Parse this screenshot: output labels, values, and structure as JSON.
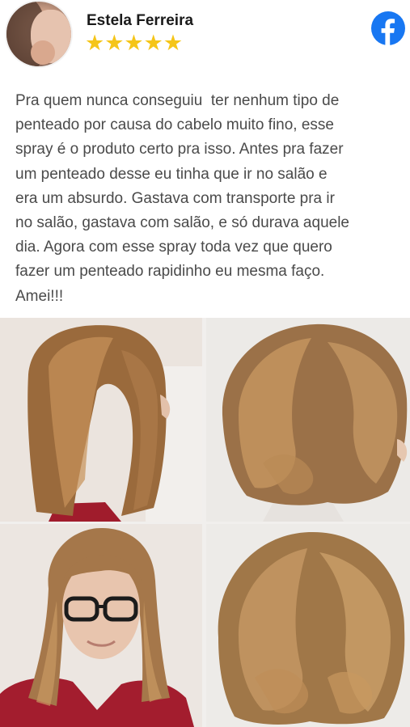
{
  "reviewer": {
    "name": "Estela Ferreira",
    "stars": "★★★★★"
  },
  "review": {
    "text": "Pra quem nunca conseguiu  ter nenhum tipo de\npenteado por causa do cabelo muito fino, esse\nspray é o produto certo pra isso. Antes pra fazer\num penteado desse eu tinha que ir no salão e\nera um absurdo. Gastava com transporte pra ir\nno salão, gastava com salão, e só durava aquele\ndia. Agora com esse spray toda vez que quero\nfazer um penteado rapidinho eu mesma faço.\nAmei!!!"
  },
  "icons": {
    "social": "facebook-icon",
    "star_color": "#f5c518",
    "facebook_color": "#1877f2"
  }
}
